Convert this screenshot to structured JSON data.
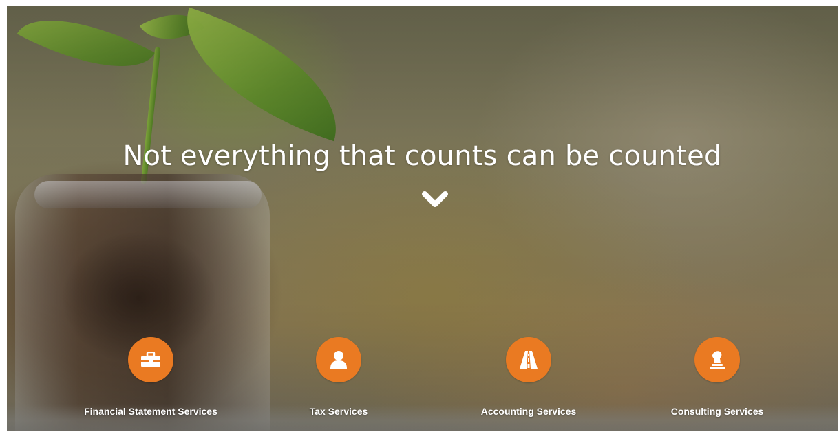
{
  "hero": {
    "headline": "Not everything that counts can be counted",
    "scroll_icon": "chevron-down-icon"
  },
  "services": [
    {
      "label": "Financial Statement Services",
      "icon": "briefcase-icon"
    },
    {
      "label": "Tax Services",
      "icon": "user-icon"
    },
    {
      "label": "Accounting Services",
      "icon": "road-icon"
    },
    {
      "label": "Consulting Services",
      "icon": "chess-knight-icon"
    }
  ],
  "colors": {
    "accent": "#ea7a22",
    "text": "#ffffff"
  }
}
